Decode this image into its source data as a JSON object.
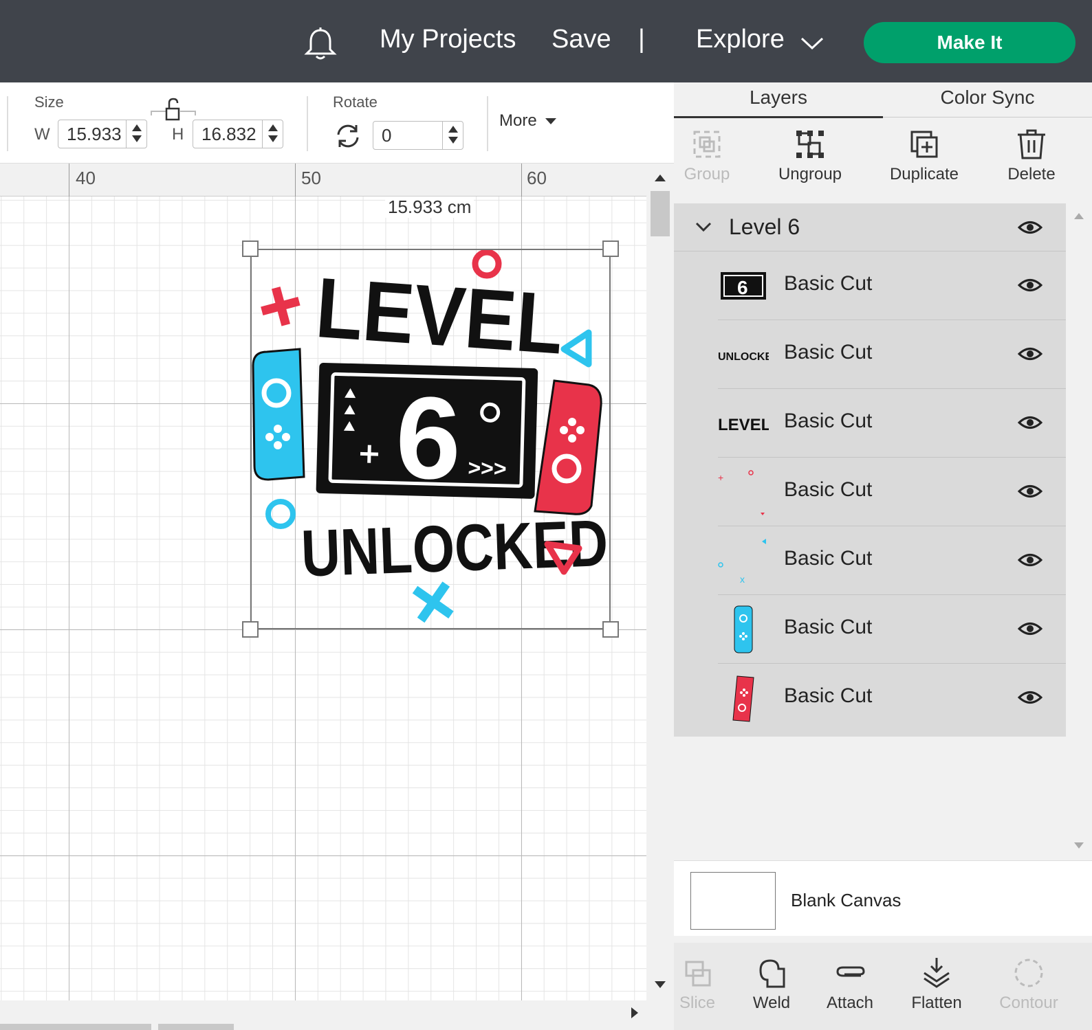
{
  "topbar": {
    "my_projects": "My Projects",
    "save": "Save",
    "separator": "|",
    "explore": "Explore",
    "make_it": "Make It",
    "make_it_color": "#00a06b",
    "bar_color": "#40444b"
  },
  "toolbar": {
    "size_label": "Size",
    "w_label": "W",
    "w_value": "15.933",
    "h_label": "H",
    "h_value": "16.832",
    "rotate_label": "Rotate",
    "rotate_value": "0",
    "more_label": "More"
  },
  "canvas": {
    "ruler_numbers": [
      "40",
      "50",
      "60"
    ],
    "width_readout": "15.933 cm",
    "design": {
      "level_text": "LEVEL",
      "number": "6",
      "unlocked_text": "UNLOCKED",
      "colors": {
        "red": "#e8334a",
        "blue": "#2ec4ee",
        "black": "#111111"
      }
    }
  },
  "panel": {
    "tabs": [
      "Layers",
      "Color Sync"
    ],
    "active_tab": "Layers",
    "tools": [
      {
        "label": "Group",
        "icon": "group-icon",
        "enabled": false
      },
      {
        "label": "Ungroup",
        "icon": "ungroup-icon",
        "enabled": true
      },
      {
        "label": "Duplicate",
        "icon": "duplicate-icon",
        "enabled": true
      },
      {
        "label": "Delete",
        "icon": "trash-icon",
        "enabled": true
      }
    ],
    "group_name": "Level 6",
    "layers": [
      {
        "name": "Basic Cut",
        "thumb": "screen-6"
      },
      {
        "name": "Basic Cut",
        "thumb": "UNLOCKED"
      },
      {
        "name": "Basic Cut",
        "thumb": "LEVEL"
      },
      {
        "name": "Basic Cut",
        "thumb": "red-shapes"
      },
      {
        "name": "Basic Cut",
        "thumb": "blue-shapes"
      },
      {
        "name": "Basic Cut",
        "thumb": "blue-controller"
      },
      {
        "name": "Basic Cut",
        "thumb": "red-controller"
      }
    ],
    "canvas_label": "Blank Canvas",
    "bottom_tools": [
      {
        "label": "Slice",
        "icon": "slice-icon",
        "enabled": false
      },
      {
        "label": "Weld",
        "icon": "weld-icon",
        "enabled": true
      },
      {
        "label": "Attach",
        "icon": "attach-icon",
        "enabled": true
      },
      {
        "label": "Flatten",
        "icon": "flatten-icon",
        "enabled": true
      },
      {
        "label": "Contour",
        "icon": "contour-icon",
        "enabled": false
      }
    ]
  }
}
